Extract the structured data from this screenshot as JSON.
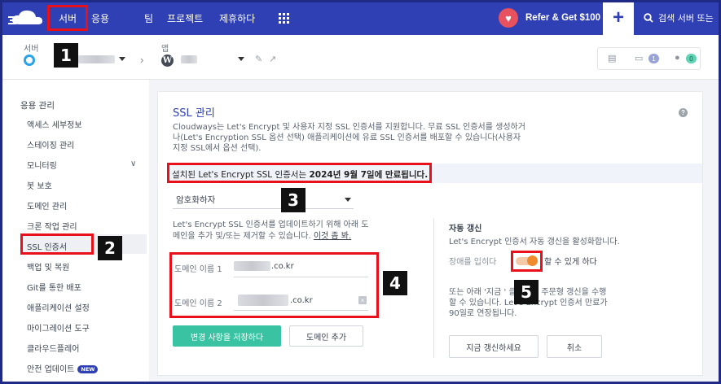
{
  "topnav": {
    "items": [
      "서버",
      "응용",
      "팀",
      "프로젝트",
      "제휴하다"
    ],
    "refer_label": "Refer & Get $100",
    "search_placeholder": "검색 서버 또는"
  },
  "subheader": {
    "server_label": "서버",
    "app_label": "앱"
  },
  "tools": {
    "count1": "1",
    "count2": "0"
  },
  "sidebar": {
    "heading": "응용 관리",
    "items": [
      "액세스 세부정보",
      "스테이징 관리",
      "모니터링",
      "봇 보호",
      "도메인 관리",
      "크론 작업 관리",
      "SSL 인증서",
      "백업 및 복원",
      "Git를 통한 배포",
      "애플리케이션 설정",
      "마이그레이션 도구",
      "클라우드플레어",
      "안전 업데이트"
    ],
    "new_badge": "NEW"
  },
  "main": {
    "title": "SSL 관리",
    "desc_line1": "Cloudways는 Let's Encrypt 및 사용자 지정 SSL 인증서를 지원합니다. 무료 SSL 인증서를 생성하거",
    "desc_line2": "나(Let's Encryption SSL 옵션 선택) 애플리케이션에 유료 SSL 인증서를 배포할 수 있습니다(사용자",
    "desc_line3": "지정 SSL에서 옵션 선택).",
    "notice_prefix": "설치된 Let's Encrypt SSL 인증서는 ",
    "notice_date": "2024년 9월 7일에 만료됩니다.",
    "dropdown_value": "암호화하자",
    "left_desc_line1": "Let's Encrypt SSL 인증서를 업데이트하기 위해 아래 도",
    "left_desc_line2": "메인을 추가 및/또는 제거할 수 있습니다.",
    "left_desc_link": "이것 좀 봐.",
    "domain1_label": "도메인 이름 1",
    "domain1_value": ".co.kr",
    "domain2_label": "도메인 이름 2",
    "domain2_value": ".co.kr",
    "save_button": "변경 사항을 저장하다",
    "add_domain_button": "도메인 추가",
    "auto_title": "자동 갱신",
    "auto_desc": "Let's Encrypt 인증서 자동 갱신을 활성화합니다.",
    "toggle_prefix": "장애를 입히다",
    "toggle_suffix": "할 수 있게 하다",
    "renew_line1": "또는 아래 '지금 ' 클릭하여 주문형 갱신을 수행",
    "renew_line2": "할 수 있습니다.  Let's Encrypt 인증서 만료가",
    "renew_line3": "90일로 연장됩니다.",
    "renew_button": "지금 갱신하세요",
    "cancel_button": "취소"
  },
  "annotations": [
    "1",
    "2",
    "3",
    "4",
    "5"
  ],
  "colors": {
    "nav": "#2f3fb4",
    "accent": "#3ac3a2",
    "annotation": "#e8101a",
    "toggle": "#f08a2c"
  }
}
